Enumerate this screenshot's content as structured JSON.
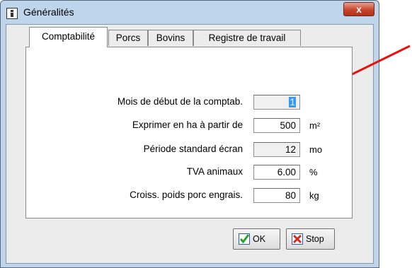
{
  "window": {
    "title": "Généralités",
    "close_label": "x"
  },
  "tabs": [
    {
      "label": "Comptabilité",
      "active": true
    },
    {
      "label": "Porcs",
      "active": false
    },
    {
      "label": "Bovins",
      "active": false
    },
    {
      "label": "Registre de travail",
      "active": false
    }
  ],
  "form": {
    "rows": [
      {
        "label": "Mois de début de la comptab.",
        "value": "1",
        "unit": "",
        "readonly": true,
        "selected": true
      },
      {
        "label": "Exprimer en ha à partir de",
        "value": "500",
        "unit": "m²",
        "readonly": false
      },
      {
        "label": "Période standard écran",
        "value": "12",
        "unit": "mo",
        "readonly": true
      },
      {
        "label": "TVA animaux",
        "value": "6.00",
        "unit": "%",
        "readonly": false
      },
      {
        "label": "Croiss. poids porc engrais.",
        "value": "80",
        "unit": "kg",
        "readonly": false
      }
    ]
  },
  "buttons": {
    "ok_label": "OK",
    "stop_label": "Stop"
  },
  "colors": {
    "accent_arrow": "#e8120c",
    "selection": "#3399ff",
    "title_bar": "#bfd5ec"
  }
}
